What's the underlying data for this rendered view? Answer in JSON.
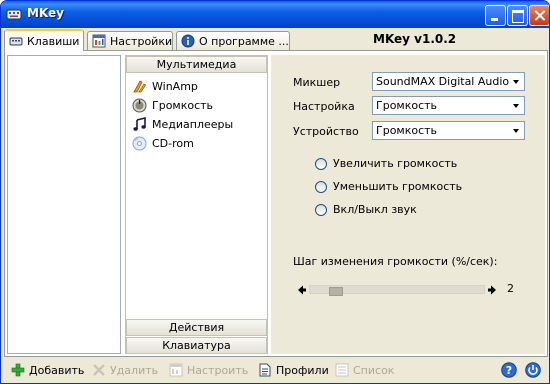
{
  "window": {
    "title": "MKey"
  },
  "tabs": [
    {
      "label": "Клавиши",
      "icon": "keyboard-icon",
      "active": true
    },
    {
      "label": "Настройки",
      "icon": "settings-icon",
      "active": false
    },
    {
      "label": "О программе ...",
      "icon": "info-icon",
      "active": false
    }
  ],
  "version": "MKey v1.0.2",
  "nav": {
    "header": "Мультимедиа",
    "items": [
      {
        "label": "WinAmp",
        "icon": "winamp-icon"
      },
      {
        "label": "Громкость",
        "icon": "volume-icon"
      },
      {
        "label": "Медиаплееры",
        "icon": "music-note-icon"
      },
      {
        "label": "CD-rom",
        "icon": "cd-icon"
      }
    ],
    "footer_sections": [
      "Действия",
      "Клавиатура"
    ]
  },
  "settings": {
    "mixer_label": "Микшер",
    "mixer_value": "SoundMAX Digital Audio",
    "setting_label": "Настройка",
    "setting_value": "Громкость",
    "device_label": "Устройство",
    "device_value": "Громкость",
    "options": [
      "Увеличить громкость",
      "Уменьшить громкость",
      "Вкл/Выкл звук"
    ],
    "step_label": "Шаг изменения громкости (%/сек):",
    "step_value": "2",
    "step_fraction": 0.05
  },
  "toolbar": {
    "add": "Добавить",
    "remove": "Удалить",
    "configure": "Настроить",
    "profiles": "Профили",
    "list": "Список"
  },
  "colors": {
    "titlebar": "#0a5fe8",
    "tab_highlight": "#ffc83c",
    "disabled_text": "#aca899"
  }
}
